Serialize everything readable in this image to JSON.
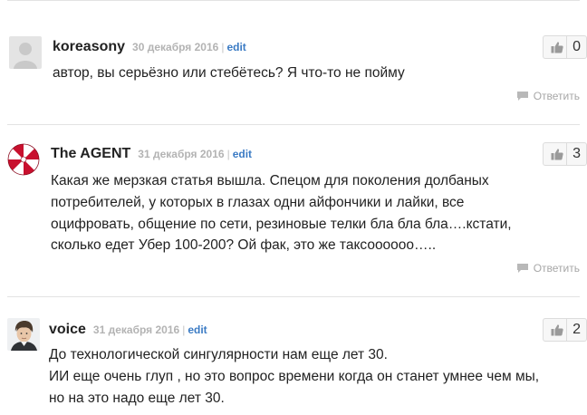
{
  "comments": [
    {
      "author": "koreasony",
      "date": "30 декабря 2016",
      "edit_label": "edit",
      "likes": "0",
      "lines": [
        "автор, вы серьёзно или стебётесь? Я что-то не пойму"
      ],
      "reply_label": "Ответить",
      "avatar": "default-user"
    },
    {
      "author": "The AGENT",
      "date": "31 декабря 2016",
      "edit_label": "edit",
      "likes": "3",
      "lines": [
        "Какая же мерзкая статья вышла. Спецом для поколения долбаных",
        "потребителей, у которых в глазах одни айфончики и лайки, все",
        "оцифровать, общение по сети, резиновые телки бла бла бла….кстати,",
        "сколько едет Убер 100-200? Ой фак, это же таксоооооо….."
      ],
      "reply_label": "Ответить",
      "avatar": "umbrella-logo"
    },
    {
      "author": "voice",
      "date": "31 декабря 2016",
      "edit_label": "edit",
      "likes": "2",
      "lines": [
        "До технологической сингулярности нам еще лет 30.",
        "ИИ еще очень глуп , но это вопрос времени когда он станет умнее чем мы,",
        "но на это надо еще лет 30."
      ],
      "reply_label": "",
      "avatar": "user-photo"
    }
  ],
  "colors": {
    "link": "#3b7bc4",
    "meta": "#b3b3b3",
    "separator": "#e3e3e3",
    "umbrella_red": "#c8102e"
  }
}
